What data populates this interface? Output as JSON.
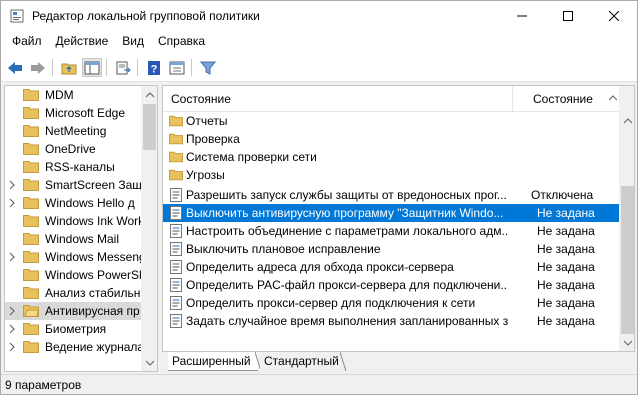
{
  "window": {
    "title": "Редактор локальной групповой политики"
  },
  "menu": [
    {
      "label": "Файл"
    },
    {
      "label": "Действие"
    },
    {
      "label": "Вид"
    },
    {
      "label": "Справка"
    }
  ],
  "tree": {
    "items": [
      {
        "label": "MDM",
        "expandable": false
      },
      {
        "label": "Microsoft Edge",
        "expandable": false
      },
      {
        "label": "NetMeeting",
        "expandable": false
      },
      {
        "label": "OneDrive",
        "expandable": false
      },
      {
        "label": "RSS-каналы",
        "expandable": false
      },
      {
        "label": "SmartScreen Защи",
        "expandable": true
      },
      {
        "label": "Windows Hello д",
        "expandable": true
      },
      {
        "label": "Windows Ink Work",
        "expandable": false
      },
      {
        "label": "Windows Mail",
        "expandable": false
      },
      {
        "label": "Windows Messeng",
        "expandable": true
      },
      {
        "label": "Windows PowerSh",
        "expandable": false
      },
      {
        "label": "Анализ стабильн",
        "expandable": false
      },
      {
        "label": "Антивирусная пр",
        "expandable": true,
        "selected": true
      },
      {
        "label": "Биометрия",
        "expandable": true
      },
      {
        "label": "Ведение журнала",
        "expandable": true
      }
    ]
  },
  "list": {
    "col_name": "Состояние",
    "col_state": "Состояние",
    "rows": [
      {
        "type": "folder",
        "name": "Отчеты",
        "state": ""
      },
      {
        "type": "folder",
        "name": "Проверка",
        "state": ""
      },
      {
        "type": "folder",
        "name": "Система проверки сети",
        "state": ""
      },
      {
        "type": "folder",
        "name": "Угрозы",
        "state": ""
      },
      {
        "type": "setting",
        "name": "Разрешить запуск службы защиты от вредоносных прог...",
        "state": "Отключена"
      },
      {
        "type": "setting",
        "name": "Выключить антивирусную программу \"Защитник Windo...",
        "state": "Не задана",
        "selected": true
      },
      {
        "type": "setting",
        "name": "Настроить объединение с параметрами локального адм...",
        "state": "Не задана"
      },
      {
        "type": "setting",
        "name": "Выключить плановое исправление",
        "state": "Не задана"
      },
      {
        "type": "setting",
        "name": "Определить адреса для обхода прокси-сервера",
        "state": "Не задана"
      },
      {
        "type": "setting",
        "name": "Определить PAC-файл прокси-сервера для подключени...",
        "state": "Не задана"
      },
      {
        "type": "setting",
        "name": "Определить прокси-сервер для подключения к сети",
        "state": "Не задана"
      },
      {
        "type": "setting",
        "name": "Задать случайное время выполнения запланированных з...",
        "state": "Не задана"
      }
    ]
  },
  "tabs": [
    {
      "label": "Расширенный"
    },
    {
      "label": "Стандартный"
    }
  ],
  "status": {
    "text": "9 параметров"
  },
  "colors": {
    "selection": "#0078d7",
    "folder": "#e8c15f",
    "toolbar_arrow": "#2b6fb6"
  },
  "icons": [
    "app-icon",
    "back-icon",
    "forward-icon",
    "up-folder-icon",
    "show-hide-tree-icon",
    "export-list-icon",
    "help-icon",
    "properties-icon",
    "filter-icon",
    "folder-icon",
    "setting-icon"
  ]
}
